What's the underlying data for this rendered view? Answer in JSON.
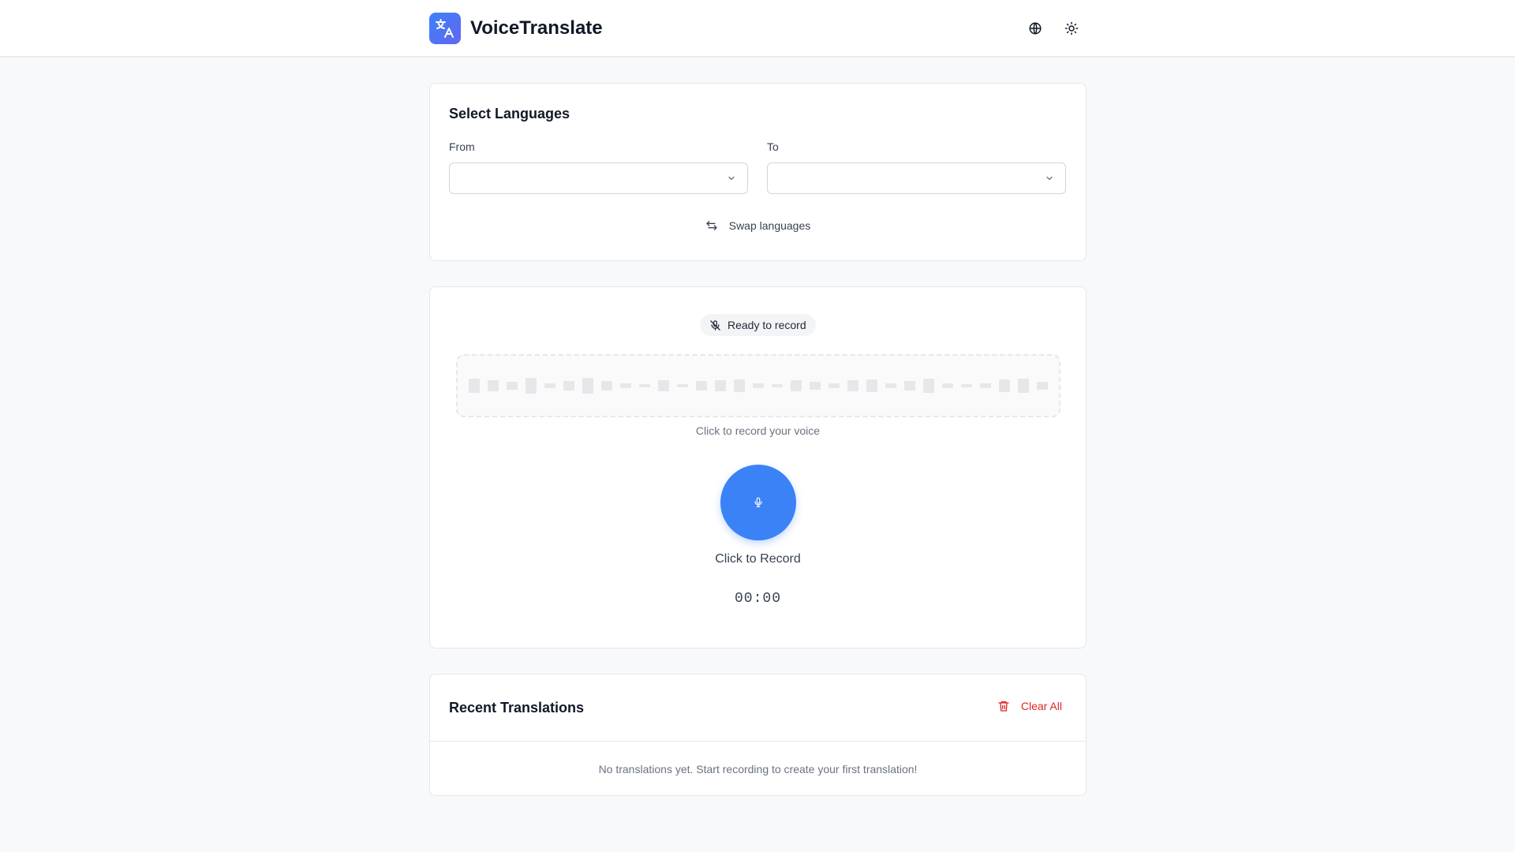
{
  "app": {
    "name": "VoiceTranslate"
  },
  "header": {
    "actions": [
      {
        "name": "language-icon"
      },
      {
        "name": "sun-icon"
      }
    ]
  },
  "languages": {
    "title": "Select Languages",
    "from_label": "From",
    "from_value": "",
    "to_label": "To",
    "to_value": "",
    "swap_label": "Swap languages"
  },
  "recorder": {
    "status": "Ready to record",
    "hint": "Click to record your voice",
    "button_label": "Click to Record",
    "timer": "00:00",
    "accent_color": "#3b82f6"
  },
  "recent": {
    "title": "Recent Translations",
    "clear_label": "Clear All",
    "empty_message": "No translations yet. Start recording to create your first translation!"
  }
}
